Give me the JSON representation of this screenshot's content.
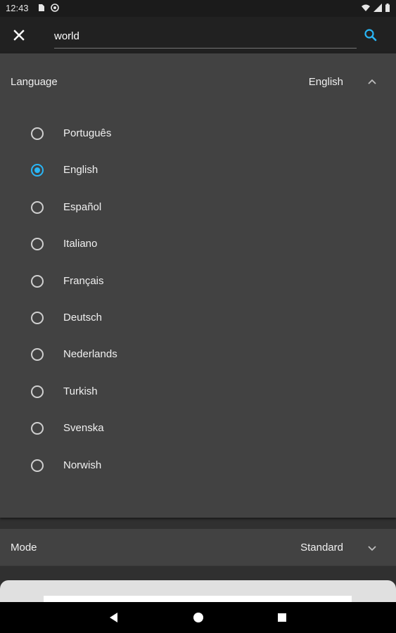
{
  "status_bar": {
    "time": "12:43",
    "left_icons": [
      "sd-card-icon",
      "at-sign-icon"
    ],
    "right_icons": [
      "wifi-icon",
      "signal-icon",
      "battery-icon"
    ]
  },
  "toolbar": {
    "search_value": "world",
    "close_icon": "close-icon",
    "search_icon": "search-icon",
    "accent_color": "#29b6f6"
  },
  "language": {
    "label": "Language",
    "value": "English",
    "expanded": true,
    "options": [
      {
        "label": "Português",
        "selected": false
      },
      {
        "label": "English",
        "selected": true
      },
      {
        "label": "Español",
        "selected": false
      },
      {
        "label": "Italiano",
        "selected": false
      },
      {
        "label": "Français",
        "selected": false
      },
      {
        "label": "Deutsch",
        "selected": false
      },
      {
        "label": "Nederlands",
        "selected": false
      },
      {
        "label": "Turkish",
        "selected": false
      },
      {
        "label": "Svenska",
        "selected": false
      },
      {
        "label": "Norwish",
        "selected": false
      }
    ]
  },
  "mode": {
    "label": "Mode",
    "value": "Standard",
    "expanded": false
  },
  "nav_bar": {
    "icons": [
      "back-icon",
      "home-icon",
      "recents-icon"
    ]
  }
}
